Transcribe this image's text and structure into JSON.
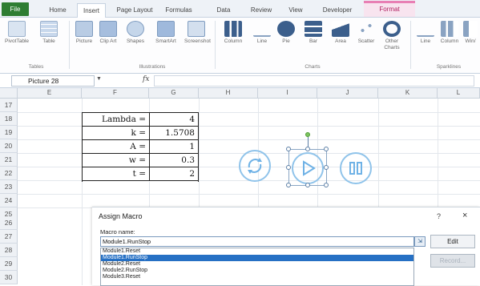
{
  "ribbon": {
    "tabs": [
      "File",
      "Home",
      "Insert",
      "Page Layout",
      "Formulas",
      "Data",
      "Review",
      "View",
      "Developer",
      "Format"
    ],
    "active_tab": "Insert",
    "buttons": {
      "pivottable": "PivotTable",
      "table": "Table",
      "picture": "Picture",
      "clipart": "Clip Art",
      "shapes": "Shapes",
      "smartart": "SmartArt",
      "screenshot": "Screenshot",
      "column": "Column",
      "line": "Line",
      "pie": "Pie",
      "bar": "Bar",
      "area": "Area",
      "scatter": "Scatter",
      "other_charts": "Other Charts",
      "spark_line": "Line",
      "spark_column": "Column",
      "spark_winloss": "Win/"
    },
    "groups": {
      "tables": "Tables",
      "illustrations": "Illustrations",
      "charts": "Charts",
      "sparklines": "Sparklines"
    }
  },
  "formula_bar": {
    "name_box": "Picture 28",
    "fx": "fx"
  },
  "grid": {
    "columns": [
      "E",
      "F",
      "G",
      "H",
      "I",
      "J",
      "K",
      "L"
    ],
    "rows": [
      "17",
      "18",
      "19",
      "20",
      "21",
      "22",
      "23",
      "24",
      "25",
      "26",
      "27",
      "28",
      "29",
      "30"
    ]
  },
  "params": [
    {
      "label": "Lambda =",
      "value": "4"
    },
    {
      "label": "k =",
      "value": "1.5708"
    },
    {
      "label": "A =",
      "value": "1"
    },
    {
      "label": "w =",
      "value": "0.3"
    },
    {
      "label": "t =",
      "value": "2"
    }
  ],
  "dialog": {
    "title": "Assign Macro",
    "help": "?",
    "close": "×",
    "macro_name_label": "Macro name:",
    "macro_name_value": "Module1.RunStop",
    "macros": [
      "Module1.Reset",
      "Module1.RunStop",
      "Module2.Reset",
      "Module2.RunStop",
      "Module3.Reset"
    ],
    "selected_index": 1,
    "edit_button": "Edit",
    "record_button": "Record..."
  },
  "colors": {
    "accent": "#2670c4",
    "file_tab": "#2e7d32",
    "shape_blue": "#8fc3ea",
    "format_tab": "#e87fb4"
  }
}
